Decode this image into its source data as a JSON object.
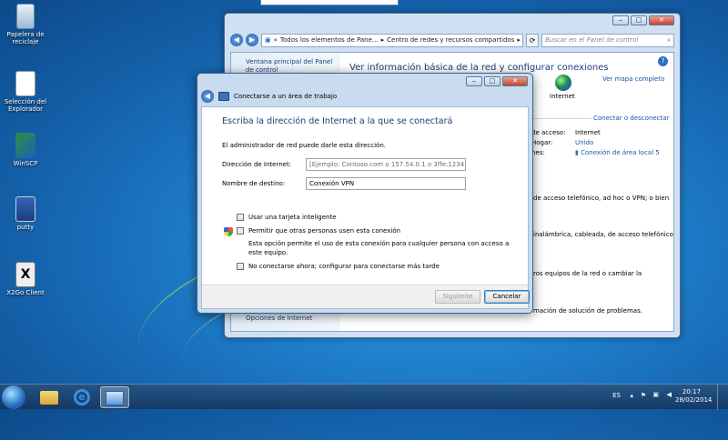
{
  "desktop": {
    "icons": [
      {
        "label": "Papelera de reciclaje",
        "icon": "recycle-bin-icon"
      },
      {
        "label": "Selección del Explorador",
        "icon": "explorer-selection-icon"
      },
      {
        "label": "WinSCP",
        "icon": "winscp-icon"
      },
      {
        "label": "putty",
        "icon": "putty-icon"
      },
      {
        "label": "X2Go Client",
        "icon": "x2go-icon"
      }
    ]
  },
  "explorer": {
    "address_parts": [
      "Todos los elementos de Pane...",
      "Centro de redes y recursos compartidos"
    ],
    "search_placeholder": "Buscar en el Panel de control",
    "left_pane_top": "Ventana principal del Panel de control",
    "left_pane_bottom": "Opciones de Internet",
    "main_title": "Ver información básica de la red y configurar conexiones",
    "full_map": "Ver mapa completo",
    "internet_label": "Internet",
    "connect_disconnect": "Conectar o desconectar",
    "access_key": "de acceso:",
    "access_value": "Internet",
    "home_key": "Hogar:",
    "home_value": "Unido",
    "connections_key": "nes:",
    "connections_value": "Conexión de área local 5",
    "desc1": "de acceso telefónico, ad hoc o VPN; o bien",
    "desc2": "inalámbrica, cableada, de acceso telefónico",
    "desc3": "ros equipos de la red o cambiar la",
    "desc4": "mación de solución de problemas."
  },
  "dialog": {
    "title": "Conectarse a un área de trabajo",
    "heading": "Escriba la dirección de Internet a la que se conectará",
    "info": "El administrador de red puede darle esta dirección.",
    "address_label": "Dirección de Internet:",
    "address_placeholder": "[Ejemplo: Contoso.com o 157.54.0.1 o 3ffe:1234::1111]",
    "dest_label": "Nombre de destino:",
    "dest_value": "Conexión VPN",
    "smartcard_label": "Usar una tarjeta inteligente",
    "allow_label": "Permitir que otras personas usen esta conexión",
    "allow_desc": "Esta opción permite el uso de esta conexión para cualquier persona con acceso a este equipo.",
    "noconnect_label": "No conectarse ahora; configurar para conectarse más tarde",
    "next_label": "Siguiente",
    "cancel_label": "Cancelar"
  },
  "taskbar": {
    "lang": "ES",
    "time": "20:17",
    "date": "28/02/2014"
  }
}
